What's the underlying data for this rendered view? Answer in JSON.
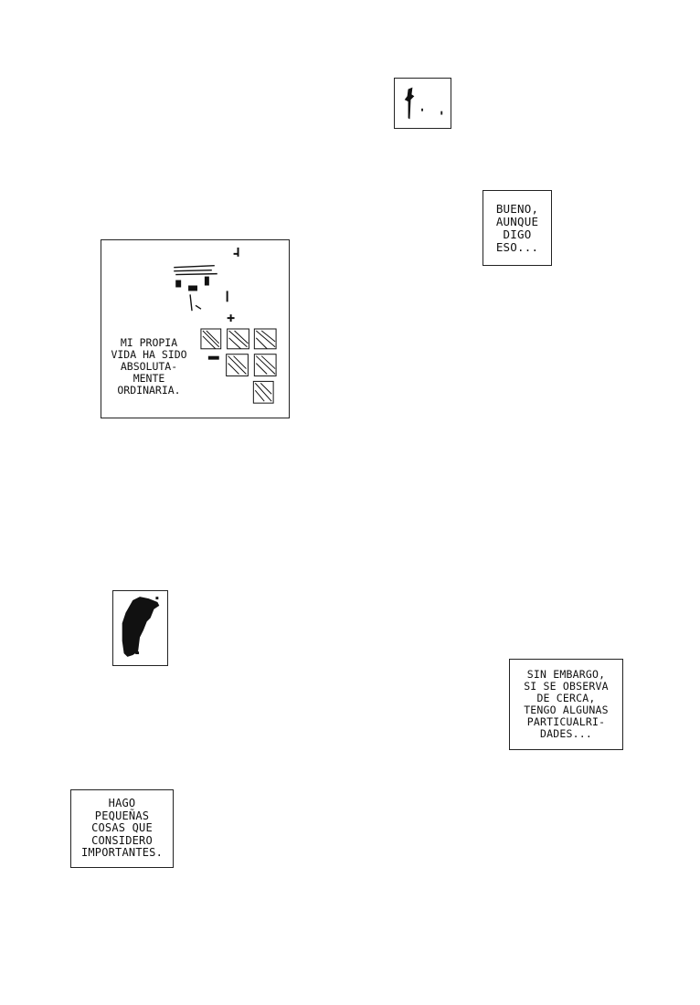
{
  "captions": {
    "bueno": [
      "BUENO,",
      "AUNQUE",
      "DIGO",
      "ESO..."
    ],
    "ordinaria": [
      "MI PROPIA",
      "VIDA HA SIDO",
      "ABSOLUTA-",
      "MENTE",
      "ORDINARIA."
    ],
    "sin_embargo": [
      "SIN EMBARGO,",
      "SI SE OBSERVA",
      "DE CERCA,",
      "TENGO ALGUNAS",
      "PARTICUALRI-",
      "DADES..."
    ],
    "hago": [
      "HAGO",
      "PEQUEÑAS",
      "COSAS QUE",
      "CONSIDERO",
      "IMPORTANTES."
    ]
  }
}
